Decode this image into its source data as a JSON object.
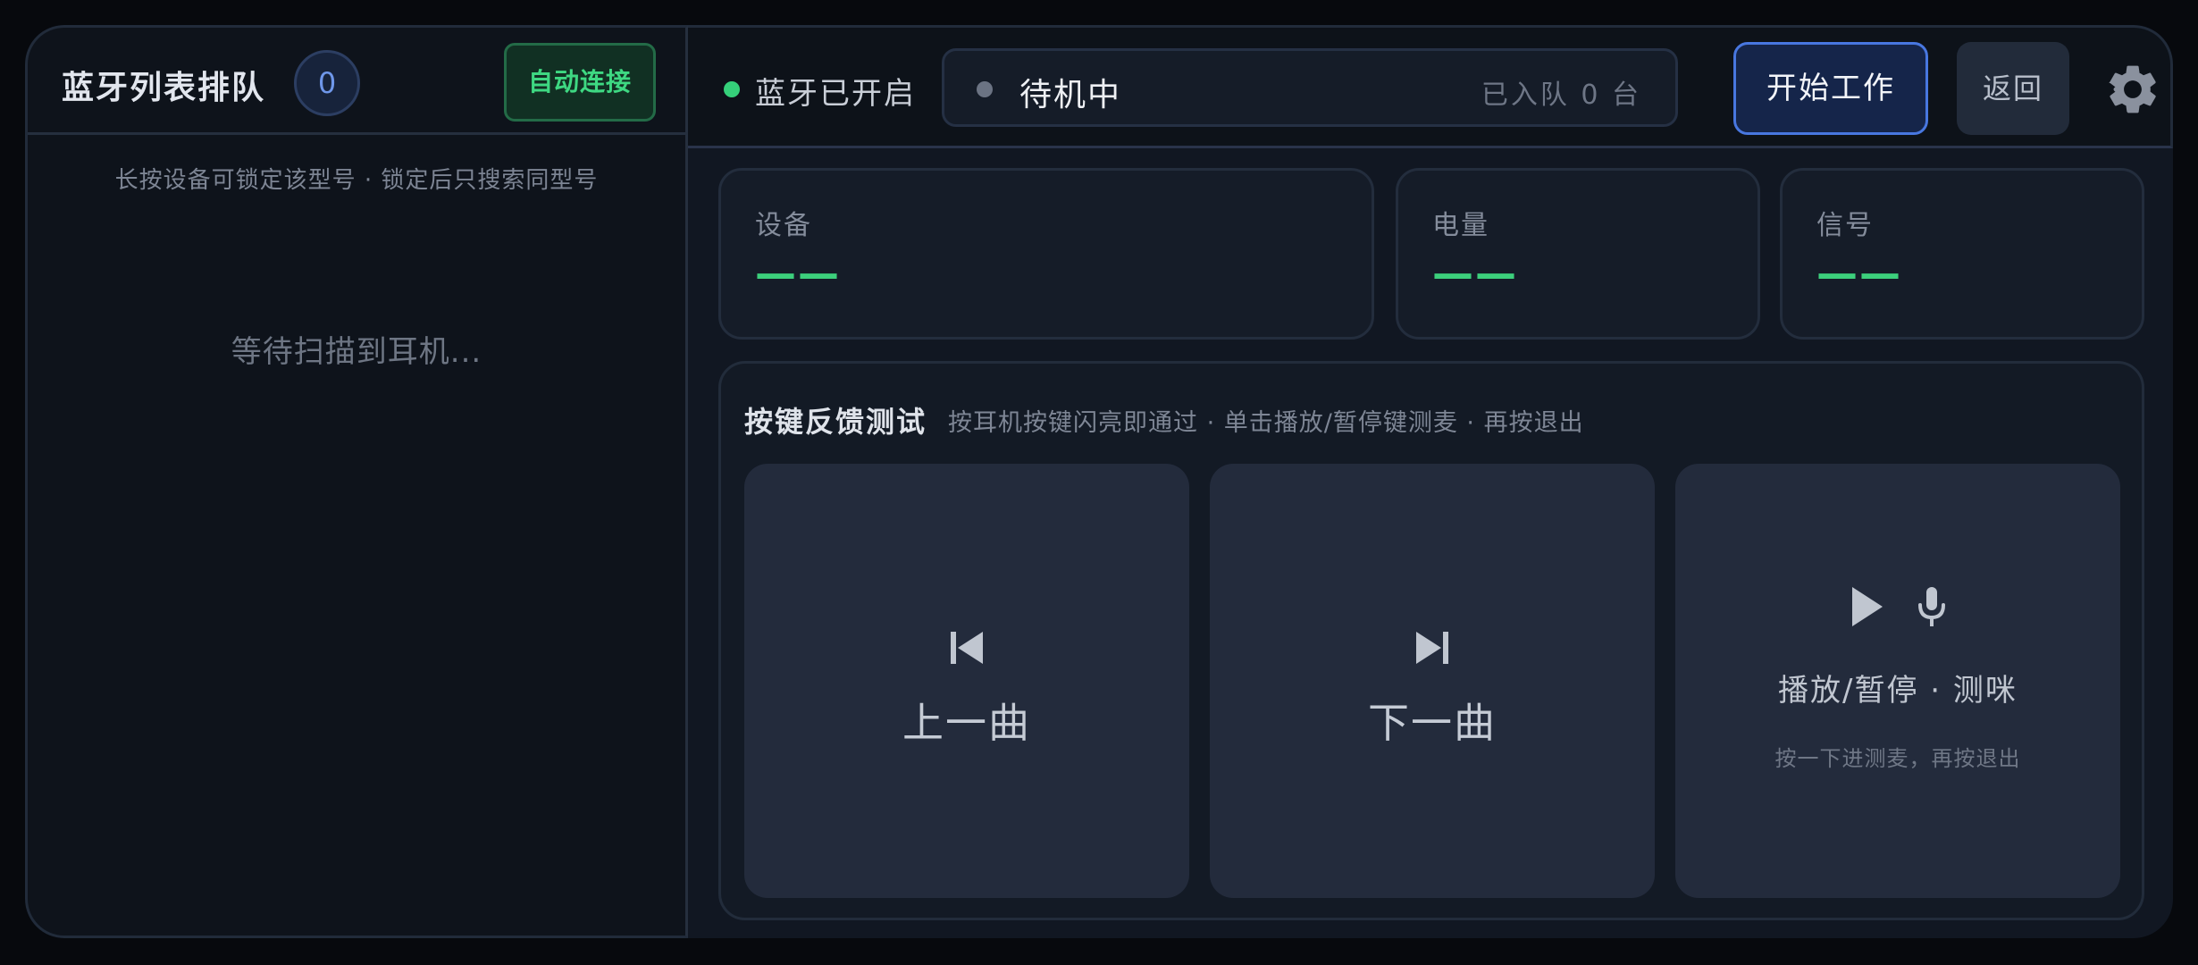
{
  "left_panel": {
    "title": "蓝牙列表排队",
    "queue_count": "0",
    "auto_connect_label": "自动连接",
    "hint": "长按设备可锁定该型号 · 锁定后只搜索同型号",
    "empty_text": "等待扫描到耳机..."
  },
  "topbar": {
    "bluetooth_status": "蓝牙已开启",
    "device_status": "待机中",
    "queued_text": "已入队 0 台",
    "start_label": "开始工作",
    "back_label": "返回"
  },
  "stats": {
    "device": {
      "label": "设备",
      "value": "——"
    },
    "battery": {
      "label": "电量",
      "value": "——"
    },
    "signal": {
      "label": "信号",
      "value": "——"
    }
  },
  "key_test": {
    "title": "按键反馈测试",
    "hint": "按耳机按键闪亮即通过 · 单击播放/暂停键测麦 · 再按退出",
    "prev_label": "上一曲",
    "next_label": "下一曲",
    "play_label": "播放/暂停 · 测咪",
    "play_sub": "按一下进测麦，再按退出"
  },
  "colors": {
    "accent_green": "#3ccf7c",
    "accent_blue": "#4877e0",
    "panel_bg": "#111722"
  },
  "icons": [
    "settings-gear-icon",
    "skip-previous-icon",
    "skip-next-icon",
    "play-icon",
    "microphone-icon"
  ]
}
